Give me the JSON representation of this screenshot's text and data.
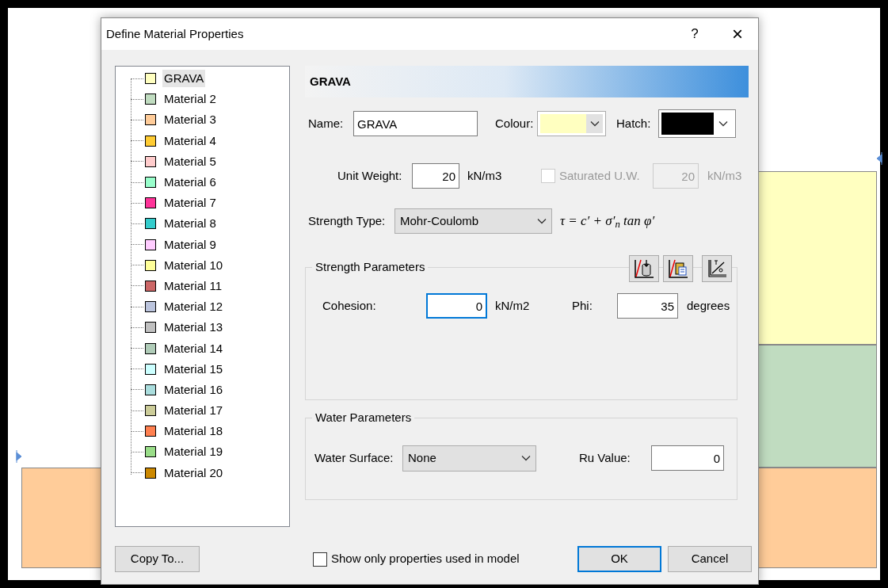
{
  "window": {
    "title": "Define Material Properties",
    "help": "?",
    "close": "×"
  },
  "materials": [
    {
      "name": "GRAVA",
      "color": "#ffffc0",
      "selected": true
    },
    {
      "name": "Material 2",
      "color": "#c0dcc0",
      "selected": false
    },
    {
      "name": "Material 3",
      "color": "#ffcc99",
      "selected": false
    },
    {
      "name": "Material 4",
      "color": "#ffcc33",
      "selected": false
    },
    {
      "name": "Material 5",
      "color": "#ffcccc",
      "selected": false
    },
    {
      "name": "Material 6",
      "color": "#99ffcc",
      "selected": false
    },
    {
      "name": "Material 7",
      "color": "#ff3399",
      "selected": false
    },
    {
      "name": "Material 8",
      "color": "#33cccc",
      "selected": false
    },
    {
      "name": "Material 9",
      "color": "#ffccff",
      "selected": false
    },
    {
      "name": "Material 10",
      "color": "#ffff99",
      "selected": false
    },
    {
      "name": "Material 11",
      "color": "#cc6666",
      "selected": false
    },
    {
      "name": "Material 12",
      "color": "#bbc4dd",
      "selected": false
    },
    {
      "name": "Material 13",
      "color": "#c0c0c0",
      "selected": false
    },
    {
      "name": "Material 14",
      "color": "#b0ccb8",
      "selected": false
    },
    {
      "name": "Material 15",
      "color": "#ccffff",
      "selected": false
    },
    {
      "name": "Material 16",
      "color": "#aadddd",
      "selected": false
    },
    {
      "name": "Material 17",
      "color": "#cccc99",
      "selected": false
    },
    {
      "name": "Material 18",
      "color": "#ff8050",
      "selected": false
    },
    {
      "name": "Material 19",
      "color": "#99dd88",
      "selected": false
    },
    {
      "name": "Material 20",
      "color": "#cc8800",
      "selected": false
    }
  ],
  "header": "GRAVA",
  "name": {
    "label": "Name:",
    "value": "GRAVA"
  },
  "colour": {
    "label": "Colour:",
    "color": "#ffffc0"
  },
  "hatch": {
    "label": "Hatch:",
    "color": "#000000"
  },
  "unit_weight": {
    "label": "Unit Weight:",
    "value": "20",
    "unit": "kN/m3"
  },
  "saturated": {
    "label": "Saturated U.W.",
    "checked": false,
    "disabled": true,
    "value": "20",
    "unit": "kN/m3"
  },
  "strength_type": {
    "label": "Strength Type:",
    "value": "Mohr-Coulomb",
    "formula": "τ = c′ + σ′$_{n}$ tan φ′"
  },
  "strength_parameters": {
    "title": "Strength Parameters",
    "fields": [
      {
        "label": "Cohesion:",
        "value": "0",
        "unit": "kN/m2",
        "focused": true
      },
      {
        "label": "Phi:",
        "value": "35",
        "unit": "degrees",
        "focused": false
      }
    ]
  },
  "water_parameters": {
    "title": "Water Parameters",
    "surface_label": "Water Surface:",
    "surface_value": "None",
    "ru_label": "Ru Value:",
    "ru_value": "0"
  },
  "footer": {
    "copy_to": "Copy To...",
    "show_only": {
      "label": "Show only properties used in model",
      "checked": false
    },
    "ok": "OK",
    "cancel": "Cancel"
  }
}
